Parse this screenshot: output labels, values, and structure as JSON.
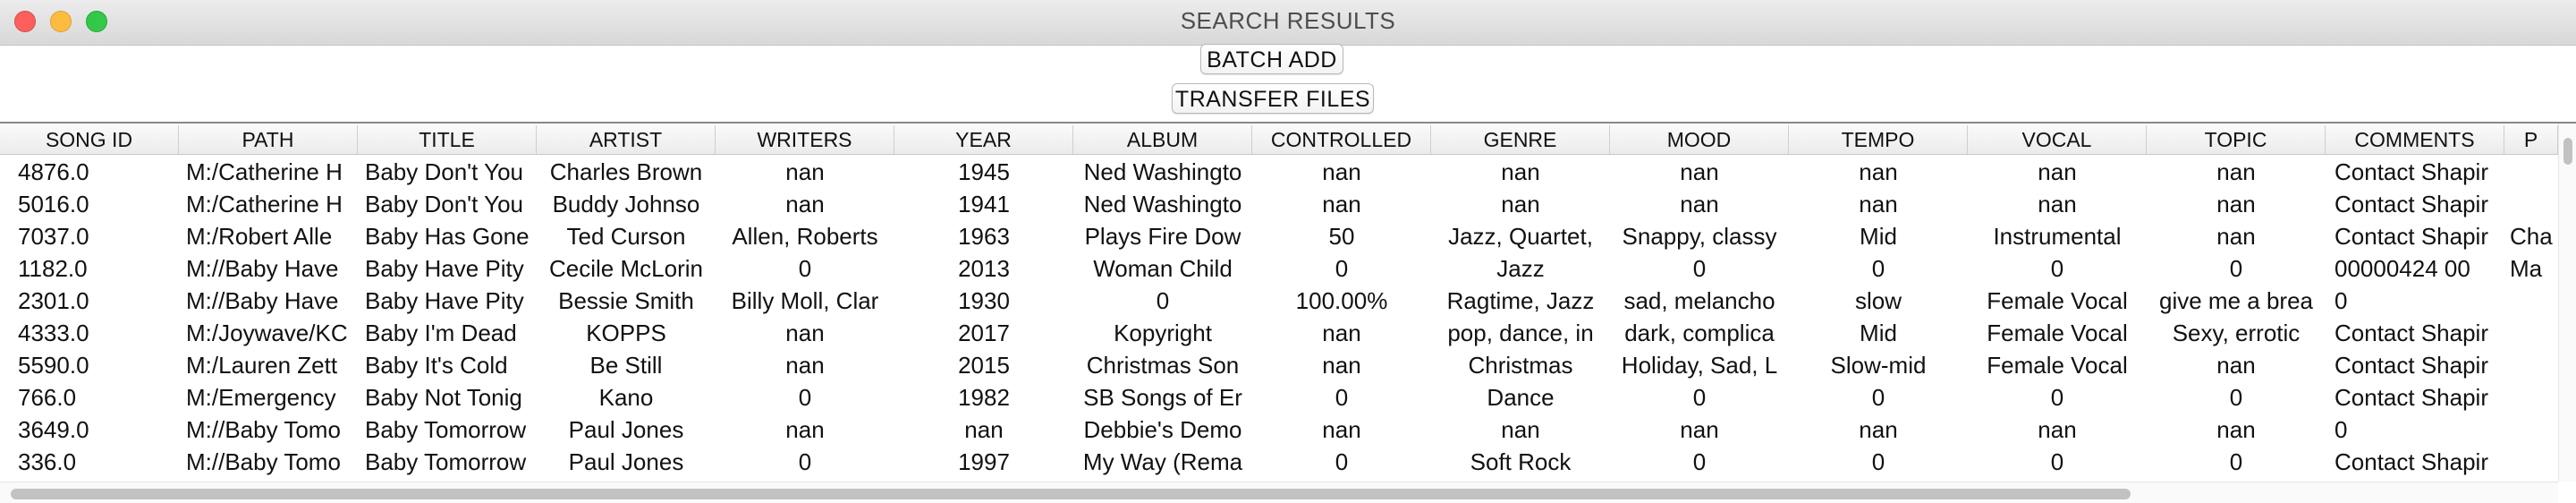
{
  "window": {
    "title": "SEARCH RESULTS"
  },
  "buttons": {
    "batch_add": "BATCH ADD",
    "transfer_files": "TRANSFER FILES"
  },
  "table": {
    "columns": [
      "SONG ID",
      "PATH",
      "TITLE",
      "ARTIST",
      "WRITERS",
      "YEAR",
      "ALBUM",
      "CONTROLLED",
      "GENRE",
      "MOOD",
      "TEMPO",
      "VOCAL",
      "TOPIC",
      "COMMENTS",
      "P"
    ],
    "rows": [
      [
        "4876.0",
        "M:/Catherine H",
        "Baby Don't You",
        "Charles Brown",
        "nan",
        "1945",
        "Ned Washingto",
        "nan",
        "nan",
        "nan",
        "nan",
        "nan",
        "nan",
        "Contact Shapir",
        ""
      ],
      [
        "5016.0",
        "M:/Catherine H",
        "Baby Don't You",
        "Buddy Johnso",
        "nan",
        "1941",
        "Ned Washingto",
        "nan",
        "nan",
        "nan",
        "nan",
        "nan",
        "nan",
        "Contact Shapir",
        ""
      ],
      [
        "7037.0",
        "M:/Robert Alle",
        "Baby Has Gone",
        "Ted Curson",
        "Allen, Roberts",
        "1963",
        "Plays Fire Dow",
        "50",
        "Jazz, Quartet,",
        "Snappy, classy",
        "Mid",
        "Instrumental",
        "nan",
        "Contact Shapir",
        "Cha"
      ],
      [
        "1182.0",
        "M://Baby Have",
        "Baby Have Pity",
        "Cecile McLorin",
        "0",
        "2013",
        "Woman Child",
        "0",
        "Jazz",
        "0",
        "0",
        "0",
        "0",
        "00000424 00",
        "Ma"
      ],
      [
        "2301.0",
        "M://Baby Have",
        "Baby Have Pity",
        "Bessie Smith",
        "Billy Moll, Clar",
        "1930",
        "0",
        "100.00%",
        "Ragtime, Jazz",
        "sad, melancho",
        "slow",
        "Female Vocal",
        "give me a brea",
        "0",
        ""
      ],
      [
        "4333.0",
        "M:/Joywave/KC",
        "Baby I'm Dead",
        "KOPPS",
        "nan",
        "2017",
        "Kopyright",
        "nan",
        "pop, dance, in",
        "dark, complica",
        "Mid",
        "Female Vocal",
        "Sexy, errotic",
        "Contact Shapir",
        ""
      ],
      [
        "5590.0",
        "M:/Lauren Zett",
        "Baby It's Cold",
        "Be Still",
        "nan",
        "2015",
        "Christmas Son",
        "nan",
        "Christmas",
        "Holiday, Sad, L",
        "Slow-mid",
        "Female Vocal",
        "nan",
        "Contact Shapir",
        ""
      ],
      [
        "766.0",
        "M:/Emergency",
        "Baby Not Tonig",
        "Kano",
        "0",
        "1982",
        "SB Songs of Er",
        "0",
        "Dance",
        "0",
        "0",
        "0",
        "0",
        "Contact Shapir",
        ""
      ],
      [
        "3649.0",
        "M://Baby Tomo",
        "Baby Tomorrow",
        "Paul Jones",
        "nan",
        "nan",
        "Debbie's Demo",
        "nan",
        "nan",
        "nan",
        "nan",
        "nan",
        "nan",
        "0",
        ""
      ],
      [
        "336.0",
        "M://Baby Tomo",
        "Baby Tomorrow",
        "Paul Jones",
        "0",
        "1997",
        "My Way (Rema",
        "0",
        "Soft Rock",
        "0",
        "0",
        "0",
        "0",
        "Contact Shapir",
        ""
      ]
    ]
  }
}
